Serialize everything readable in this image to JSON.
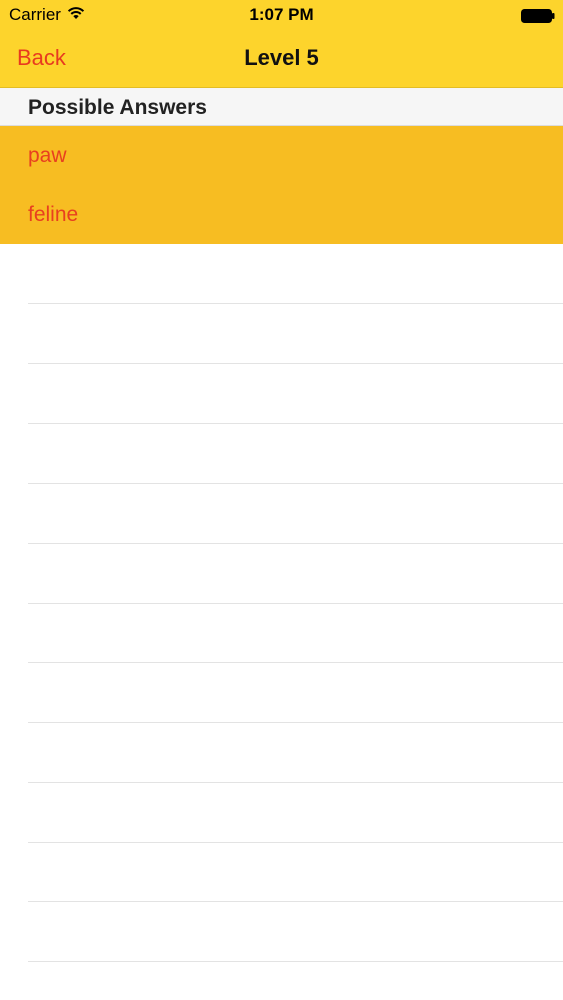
{
  "status_bar": {
    "carrier": "Carrier",
    "time": "1:07 PM"
  },
  "nav": {
    "back_label": "Back",
    "title": "Level 5"
  },
  "section": {
    "title": "Possible Answers"
  },
  "answers": [
    {
      "label": "paw"
    },
    {
      "label": "feline"
    }
  ],
  "icons": {
    "wifi": "wifi-icon",
    "battery": "battery-icon"
  },
  "colors": {
    "nav_background": "#fdd42c",
    "answers_background": "#f7bd22",
    "accent": "#e83a1f",
    "section_background": "#f6f6f6"
  }
}
